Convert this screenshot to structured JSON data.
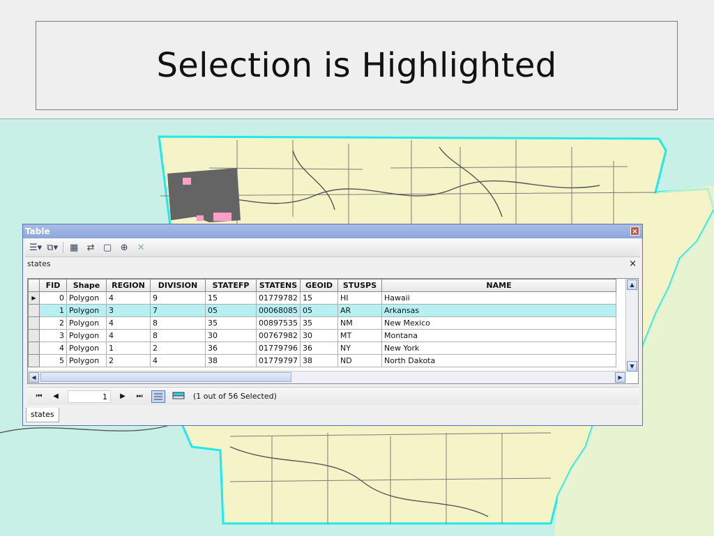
{
  "slide": {
    "title": "Selection is Highlighted"
  },
  "map": {
    "selected_state": "Arkansas",
    "outline_color": "#22e8ea",
    "land_color": "#f4f4c8",
    "water_color": "#c8f0e6",
    "selection_fill": "#646464"
  },
  "table_window": {
    "title": "Table",
    "close_label": "×",
    "toolbar": {
      "table_options_icon": "table-options-icon",
      "related_tables_icon": "related-tables-icon",
      "select_by_attributes_icon": "select-by-attributes-icon",
      "switch_selection_icon": "switch-selection-icon",
      "clear_selection_icon": "clear-selection-icon",
      "zoom_to_selected_icon": "zoom-to-selected-icon",
      "delete_selected_icon": "delete-selected-icon"
    },
    "tab_name": "states",
    "tab_close": "×",
    "columns": [
      "FID",
      "Shape",
      "REGION",
      "DIVISION",
      "STATEFP",
      "STATENS",
      "GEOID",
      "STUSPS",
      "NAME"
    ],
    "rows": [
      {
        "fid": "0",
        "shape": "Polygon",
        "region": "4",
        "division": "9",
        "statefp": "15",
        "statens": "01779782",
        "geoid": "15",
        "stusps": "HI",
        "name": "Hawaii",
        "current": true,
        "selected": false
      },
      {
        "fid": "1",
        "shape": "Polygon",
        "region": "3",
        "division": "7",
        "statefp": "05",
        "statens": "00068085",
        "geoid": "05",
        "stusps": "AR",
        "name": "Arkansas",
        "current": false,
        "selected": true
      },
      {
        "fid": "2",
        "shape": "Polygon",
        "region": "4",
        "division": "8",
        "statefp": "35",
        "statens": "00897535",
        "geoid": "35",
        "stusps": "NM",
        "name": "New Mexico",
        "current": false,
        "selected": false
      },
      {
        "fid": "3",
        "shape": "Polygon",
        "region": "4",
        "division": "8",
        "statefp": "30",
        "statens": "00767982",
        "geoid": "30",
        "stusps": "MT",
        "name": "Montana",
        "current": false,
        "selected": false
      },
      {
        "fid": "4",
        "shape": "Polygon",
        "region": "1",
        "division": "2",
        "statefp": "36",
        "statens": "01779796",
        "geoid": "36",
        "stusps": "NY",
        "name": "New York",
        "current": false,
        "selected": false
      },
      {
        "fid": "5",
        "shape": "Polygon",
        "region": "2",
        "division": "4",
        "statefp": "38",
        "statens": "01779797",
        "geoid": "38",
        "stusps": "ND",
        "name": "North Dakota",
        "current": false,
        "selected": false
      }
    ],
    "nav": {
      "first": "⏮",
      "prev": "◀",
      "record": "1",
      "next": "▶",
      "last": "⏭",
      "status": "(1 out of 56 Selected)"
    },
    "bottom_tab": "states",
    "selection_color": "#b6f0f2"
  }
}
